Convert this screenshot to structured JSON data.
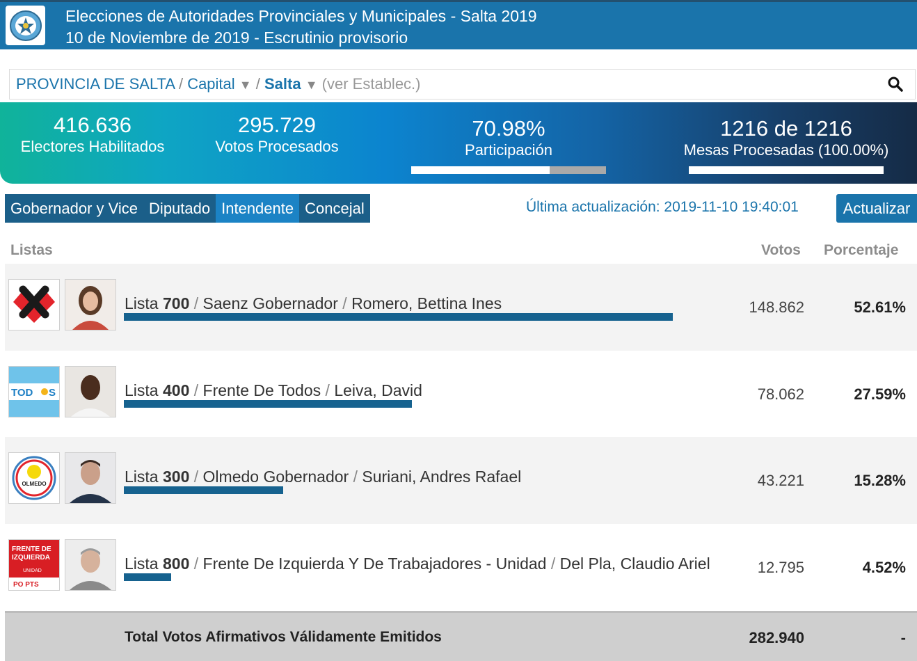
{
  "header": {
    "title": "Elecciones de Autoridades Provinciales y Municipales - Salta 2019",
    "subtitle": "10 de Noviembre de 2019 - Escrutinio provisorio"
  },
  "breadcrumb": {
    "province": "PROVINCIA DE SALTA",
    "sep": "/",
    "department": "Capital",
    "municipality": "Salta",
    "establishments": "(ver Establec.)",
    "dropdown_glyph": "▼"
  },
  "stats": {
    "electors": {
      "value": "416.636",
      "label": "Electores Habilitados"
    },
    "processed_votes": {
      "value": "295.729",
      "label": "Votos Procesados"
    },
    "participation": {
      "value": "70.98%",
      "label": "Participación",
      "fill_percent": 70.98
    },
    "tables": {
      "value": "1216 de 1216",
      "label": "Mesas Procesadas (100.00%)",
      "fill_percent": 100
    }
  },
  "tabs": [
    {
      "label": "Gobernador y Vice",
      "active": false
    },
    {
      "label": "Diputado",
      "active": false
    },
    {
      "label": "Intendente",
      "active": true
    },
    {
      "label": "Concejal",
      "active": false
    }
  ],
  "last_update": "Última actualización: 2019-11-10 19:40:01",
  "refresh_label": "Actualizar",
  "table": {
    "headers": {
      "lists": "Listas",
      "votes": "Votos",
      "percent": "Porcentaje"
    },
    "rows": [
      {
        "lista_word": "Lista",
        "number": "700",
        "party": "Saenz Gobernador",
        "candidate": "Romero, Bettina Ines",
        "votes": "148.862",
        "percent": "52.61%",
        "bar_percent": 52.61
      },
      {
        "lista_word": "Lista",
        "number": "400",
        "party": "Frente De Todos",
        "candidate": "Leiva, David",
        "votes": "78.062",
        "percent": "27.59%",
        "bar_percent": 27.59
      },
      {
        "lista_word": "Lista",
        "number": "300",
        "party": "Olmedo Gobernador",
        "candidate": "Suriani, Andres Rafael",
        "votes": "43.221",
        "percent": "15.28%",
        "bar_percent": 15.28
      },
      {
        "lista_word": "Lista",
        "number": "800",
        "party": "Frente De Izquierda Y De Trabajadores - Unidad",
        "candidate": "Del Pla, Claudio Ariel",
        "votes": "12.795",
        "percent": "4.52%",
        "bar_percent": 4.52
      }
    ],
    "total": {
      "label": "Total Votos Afirmativos Válidamente Emitidos",
      "votes": "282.940",
      "percent": "-"
    }
  },
  "logos": {
    "row1": "heart-x-logo",
    "row2": {
      "text_a": "TOD",
      "text_b": "S"
    },
    "row3": {
      "text": "OLMEDO"
    },
    "row4": {
      "line1": "FRENTE DE",
      "line2": "IZQUIERDA",
      "line3": "UNIDAD",
      "line4": "PO PTS"
    }
  },
  "colors": {
    "header_bg": "#1a74ab",
    "accent": "#1a74ab",
    "bar": "#16628f",
    "tab_bg": "#1b5f89",
    "tab_active": "#1b83c5"
  }
}
